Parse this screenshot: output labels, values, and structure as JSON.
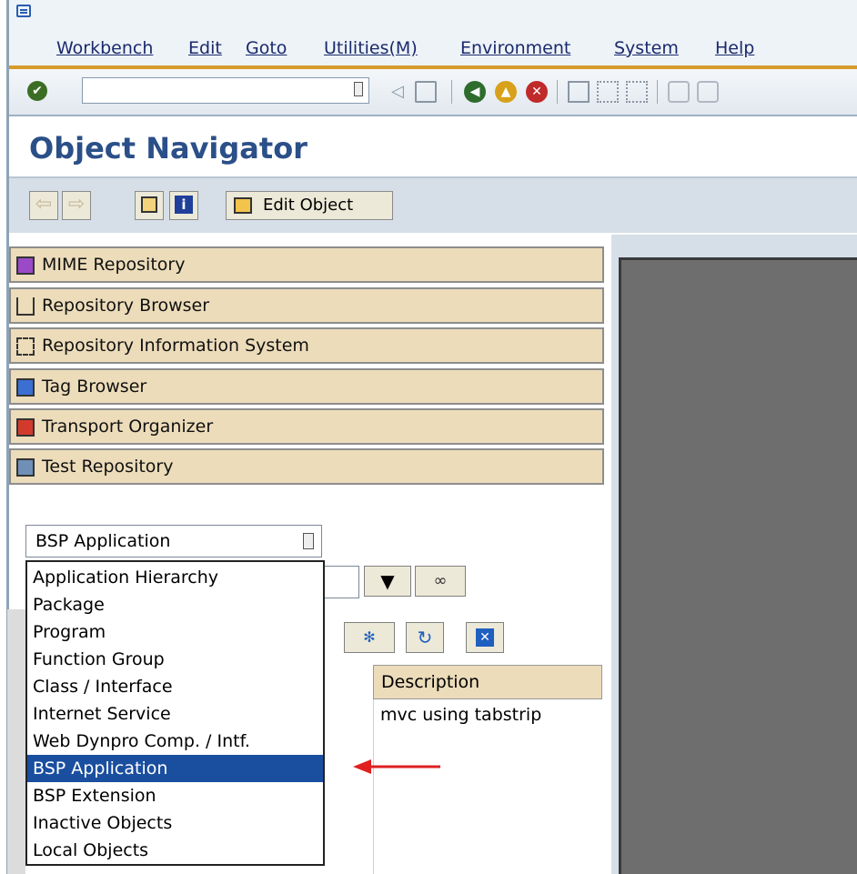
{
  "menu": {
    "items": [
      {
        "label": "Workbench"
      },
      {
        "label": "Edit"
      },
      {
        "label": "Goto"
      },
      {
        "label": "Utilities(M)"
      },
      {
        "label": "Environment"
      },
      {
        "label": "System"
      },
      {
        "label": "Help"
      }
    ]
  },
  "toolbar": {
    "command_field_value": "",
    "icons": [
      "ok-icon",
      "back-icon",
      "exit-icon",
      "cancel-icon",
      "print-icon",
      "find-icon",
      "find-next-icon",
      "first-page-icon",
      "prev-page-icon"
    ]
  },
  "page_title": "Object Navigator",
  "app_toolbar": {
    "edit_object_label": "Edit Object"
  },
  "navigator": {
    "buttons": [
      {
        "label": "MIME Repository"
      },
      {
        "label": "Repository Browser"
      },
      {
        "label": "Repository Information System"
      },
      {
        "label": "Tag Browser"
      },
      {
        "label": "Transport Organizer"
      },
      {
        "label": "Test Repository"
      }
    ],
    "object_type_selected": "BSP Application",
    "object_type_options": [
      "Application Hierarchy",
      "Package",
      "Program",
      "Function Group",
      "Class / Interface",
      "Internet Service",
      "Web Dynpro Comp. / Intf.",
      "BSP Application",
      "BSP Extension",
      "Inactive Objects",
      "Local Objects"
    ],
    "highlighted_option": "BSP Application"
  },
  "object_list": {
    "column_description": "Description",
    "rows": [
      {
        "description": "mvc using tabstrip"
      }
    ]
  },
  "colors": {
    "menu_text": "#1a2a6c",
    "title": "#2b4f88",
    "nav_button": "#ecdcba",
    "selection": "#1a4e9f",
    "annotation_arrow": "#e02020"
  }
}
